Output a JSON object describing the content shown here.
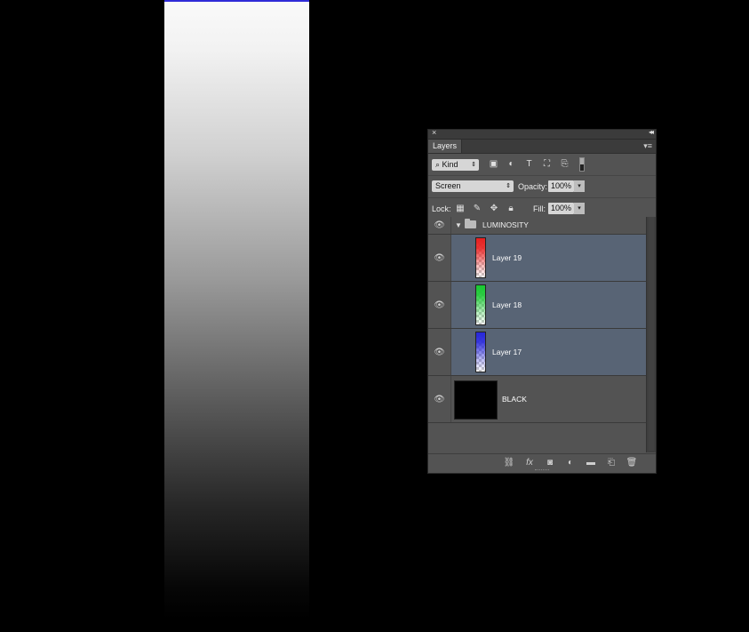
{
  "panel": {
    "tab_label": "Layers",
    "close_glyph": "×",
    "collapse_glyph": "◂◂",
    "menu_glyph": "▾≡",
    "filter": {
      "kind_label": "Kind",
      "icons": [
        "image-filter-icon",
        "adjustment-filter-icon",
        "type-filter-icon",
        "shape-filter-icon",
        "smart-object-filter-icon"
      ]
    },
    "blend": {
      "mode": "Screen",
      "opacity_label": "Opacity:",
      "opacity_value": "100%"
    },
    "lock": {
      "label": "Lock:",
      "fill_label": "Fill:",
      "fill_value": "100%"
    },
    "layers": [
      {
        "name": "LUMINOSITY",
        "type": "group"
      },
      {
        "name": "Layer 19",
        "color": "#e82020"
      },
      {
        "name": "Layer 18",
        "color": "#19c832"
      },
      {
        "name": "Layer 17",
        "color": "#2626d9"
      },
      {
        "name": "BLACK",
        "color": "#000000"
      }
    ],
    "bottom_icons": [
      "link-layers-icon",
      "fx-icon",
      "add-mask-icon",
      "new-adjustment-icon",
      "new-group-icon",
      "new-layer-icon",
      "delete-layer-icon"
    ]
  },
  "colors": {
    "panel_bg": "#535353",
    "selected_row": "#586475",
    "accent_line": "#2f2bd8"
  }
}
